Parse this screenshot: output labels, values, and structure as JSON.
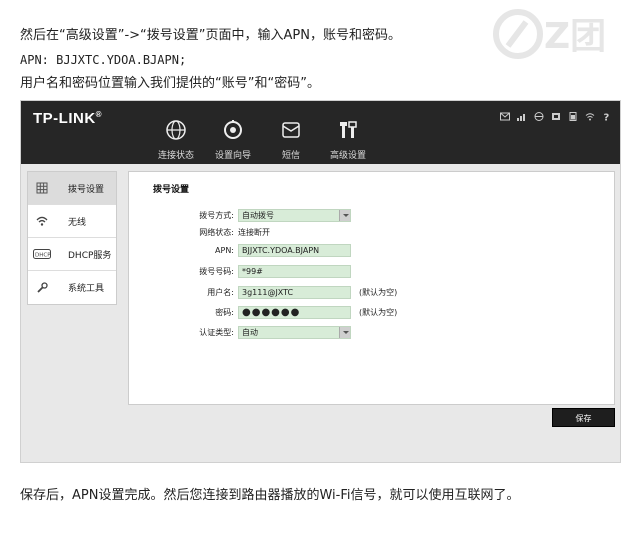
{
  "intro": {
    "line1": "然后在“高级设置”->“拨号设置”页面中，输入APN，账号和密码。",
    "line2": "APN: BJJXTC.YDOA.BJAPN;",
    "line3": "用户名和密码位置输入我们提供的“账号”和“密码”。"
  },
  "router": {
    "brand": "TP-LINK",
    "trademark": "®",
    "nav": [
      {
        "label": "连接状态",
        "icon": "globe-icon"
      },
      {
        "label": "设置向导",
        "icon": "setup-wizard-icon"
      },
      {
        "label": "短信",
        "icon": "envelope-icon"
      },
      {
        "label": "高级设置",
        "icon": "tools-icon"
      }
    ],
    "status_icons": [
      "mail-icon",
      "signal-icon",
      "globe-icon",
      "sim-icon",
      "battery-icon",
      "wifi-icon",
      "help-icon"
    ],
    "sidebar": [
      {
        "label": "拨号设置",
        "icon": "dial-icon",
        "active": true
      },
      {
        "label": "无线",
        "icon": "wifi-icon",
        "active": false
      },
      {
        "label": "DHCP服务",
        "icon": "dhcp-icon",
        "active": false
      },
      {
        "label": "系统工具",
        "icon": "wrench-icon",
        "active": false
      }
    ],
    "panel": {
      "title": "拨号设置",
      "fields": {
        "dial_mode": {
          "label": "拨号方式:",
          "value": "自动拨号"
        },
        "net_status": {
          "label": "网络状态:",
          "value": "连接断开"
        },
        "apn": {
          "label": "APN:",
          "value": "BJJXTC.YDOA.BJAPN"
        },
        "dial_number": {
          "label": "拨号号码:",
          "value": "*99#"
        },
        "username": {
          "label": "用户名:",
          "value": "3g111@JXTC",
          "note": "(默认为空)"
        },
        "password": {
          "label": "密码:",
          "value": "●●●●●●",
          "note": "(默认为空)"
        },
        "auth_type": {
          "label": "认证类型:",
          "value": "自动"
        }
      }
    },
    "save_label": "保存"
  },
  "outro": "保存后，APN设置完成。然后您连接到路由器播放的Wi-Fi信号，就可以使用互联网了。",
  "colors": {
    "topbar": "#262626",
    "field_bg": "#d8ecd8",
    "sidebar_active": "#dcdcdc",
    "page_bg": "#e8e8e8"
  }
}
